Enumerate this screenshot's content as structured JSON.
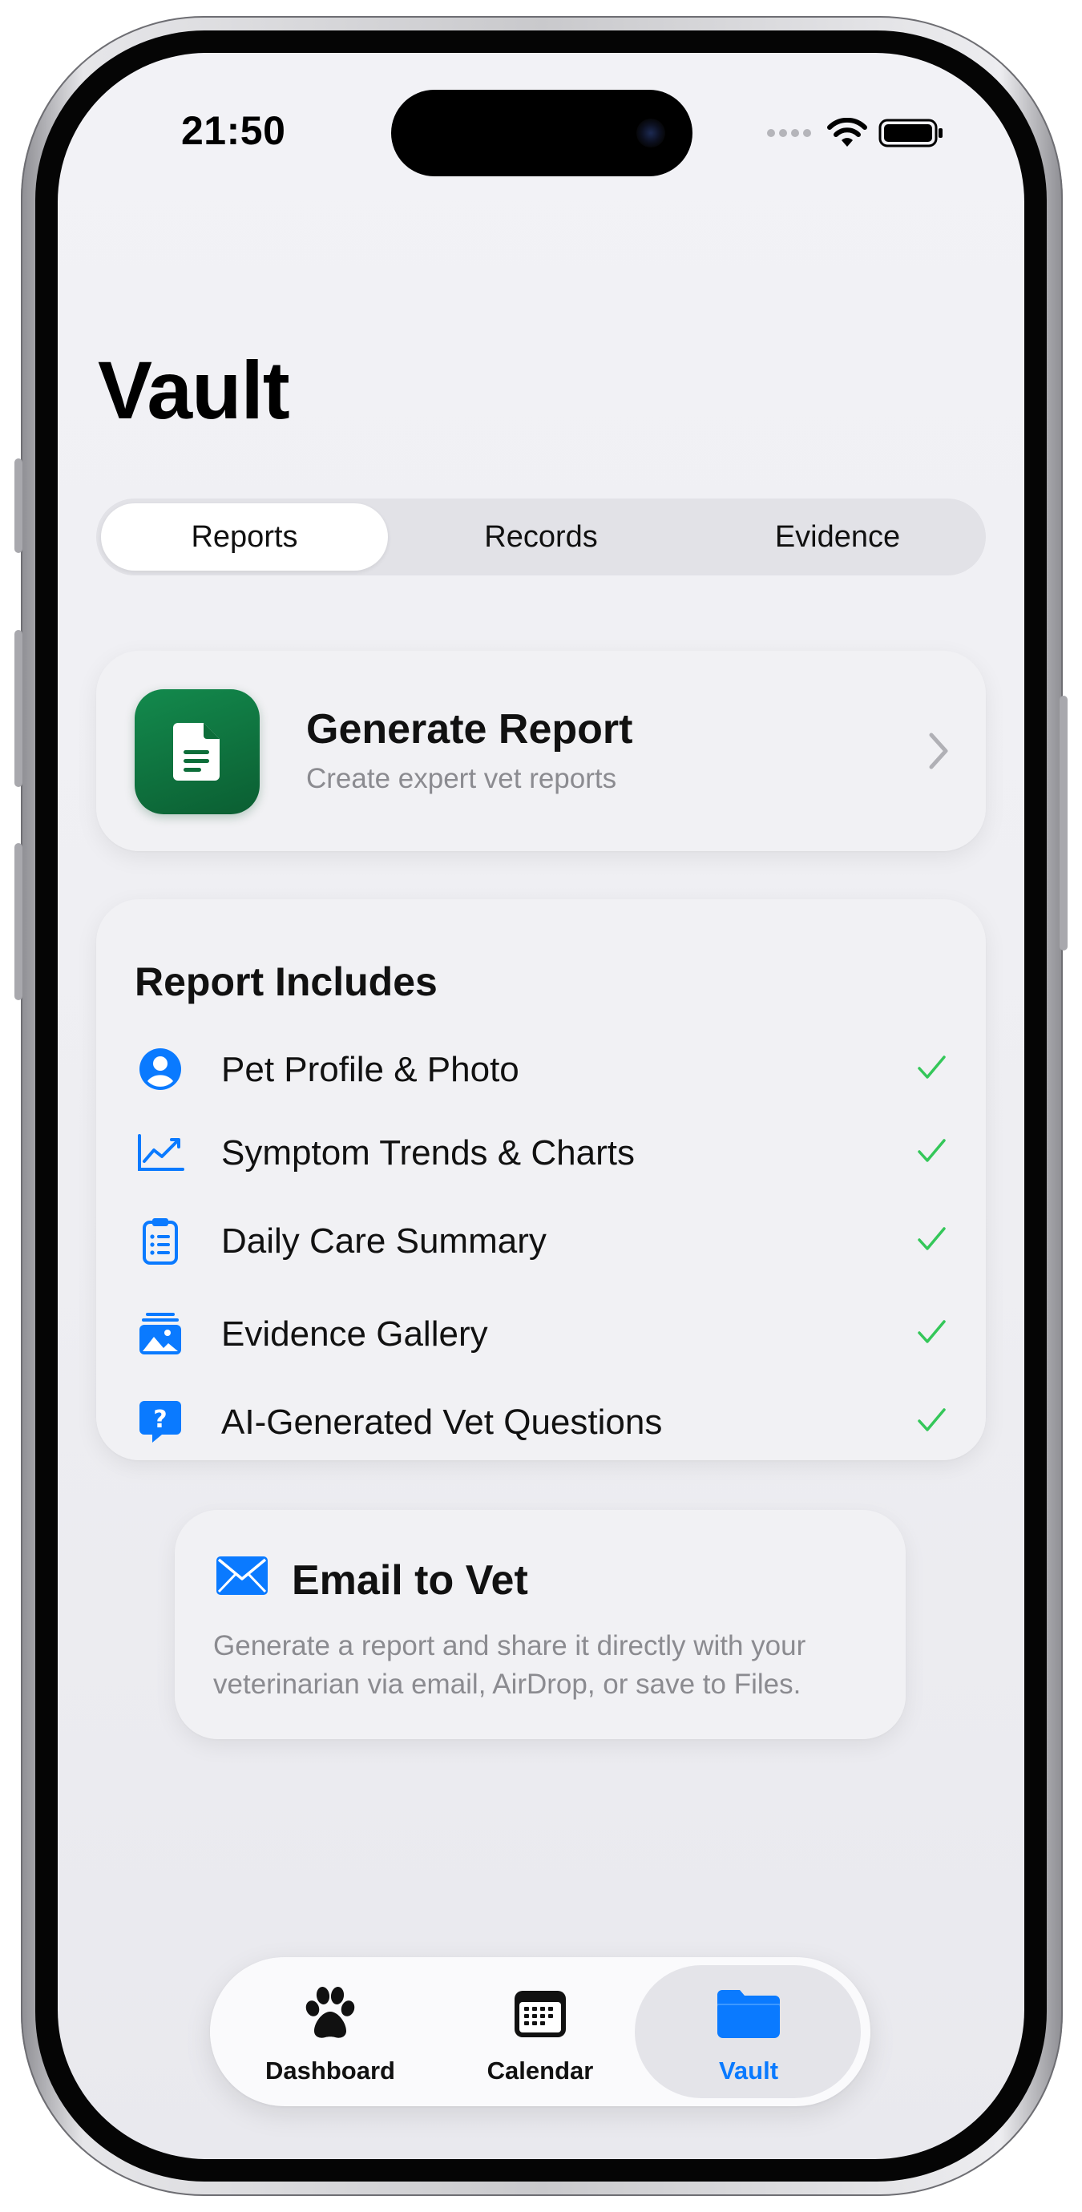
{
  "status_bar": {
    "time": "21:50"
  },
  "page": {
    "title": "Vault"
  },
  "segments": {
    "items": [
      "Reports",
      "Records",
      "Evidence"
    ],
    "selected": "Reports"
  },
  "generate_card": {
    "title": "Generate Report",
    "subtitle": "Create expert vet reports",
    "icon": "document-icon"
  },
  "includes": {
    "title": "Report Includes",
    "items": [
      {
        "label": "Pet Profile & Photo",
        "icon": "person-circle-icon",
        "checked": true
      },
      {
        "label": "Symptom Trends & Charts",
        "icon": "chart-line-icon",
        "checked": true
      },
      {
        "label": "Daily Care Summary",
        "icon": "clipboard-icon",
        "checked": true
      },
      {
        "label": "Evidence Gallery",
        "icon": "photo-stack-icon",
        "checked": true
      },
      {
        "label": "AI-Generated Vet Questions",
        "icon": "question-bubble-icon",
        "checked": true
      }
    ]
  },
  "email_card": {
    "title": "Email to Vet",
    "icon": "envelope-icon",
    "body": "Generate a report and share it directly with your veterinarian via email, AirDrop, or save to Files."
  },
  "tabbar": {
    "items": [
      {
        "label": "Dashboard",
        "icon": "paw-icon"
      },
      {
        "label": "Calendar",
        "icon": "calendar-icon"
      },
      {
        "label": "Vault",
        "icon": "folder-icon"
      }
    ],
    "selected": "Vault"
  },
  "colors": {
    "accent": "#0a7aff",
    "brand_green": "#0f7a42",
    "check_green": "#34c759",
    "secondary_text": "#8b8b90"
  }
}
